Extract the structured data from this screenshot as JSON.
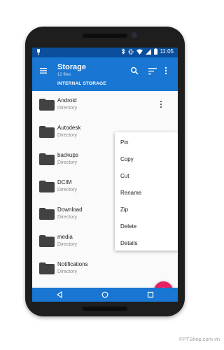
{
  "status_bar": {
    "time": "11:05"
  },
  "app_bar": {
    "title": "Storage",
    "subtitle": "12 files",
    "section_label": "INTERNAL STORAGE"
  },
  "files": [
    {
      "name": "Android",
      "type": "Directory"
    },
    {
      "name": "Autodesk",
      "type": "Directory"
    },
    {
      "name": "backups",
      "type": "Directory"
    },
    {
      "name": "DCIM",
      "type": "Directory"
    },
    {
      "name": "Download",
      "type": "Directory"
    },
    {
      "name": "media",
      "type": "Directory"
    },
    {
      "name": "Notifications",
      "type": "Directory"
    }
  ],
  "context_menu": {
    "items": [
      "Pin",
      "Copy",
      "Cut",
      "Rename",
      "Zip",
      "Delete",
      "Details"
    ]
  },
  "fab": {
    "label": "+"
  },
  "colors": {
    "primary": "#1976d2",
    "status_bar": "#0b4f9c",
    "accent": "#e91e63"
  },
  "watermark": "FPTShop.com.vn"
}
